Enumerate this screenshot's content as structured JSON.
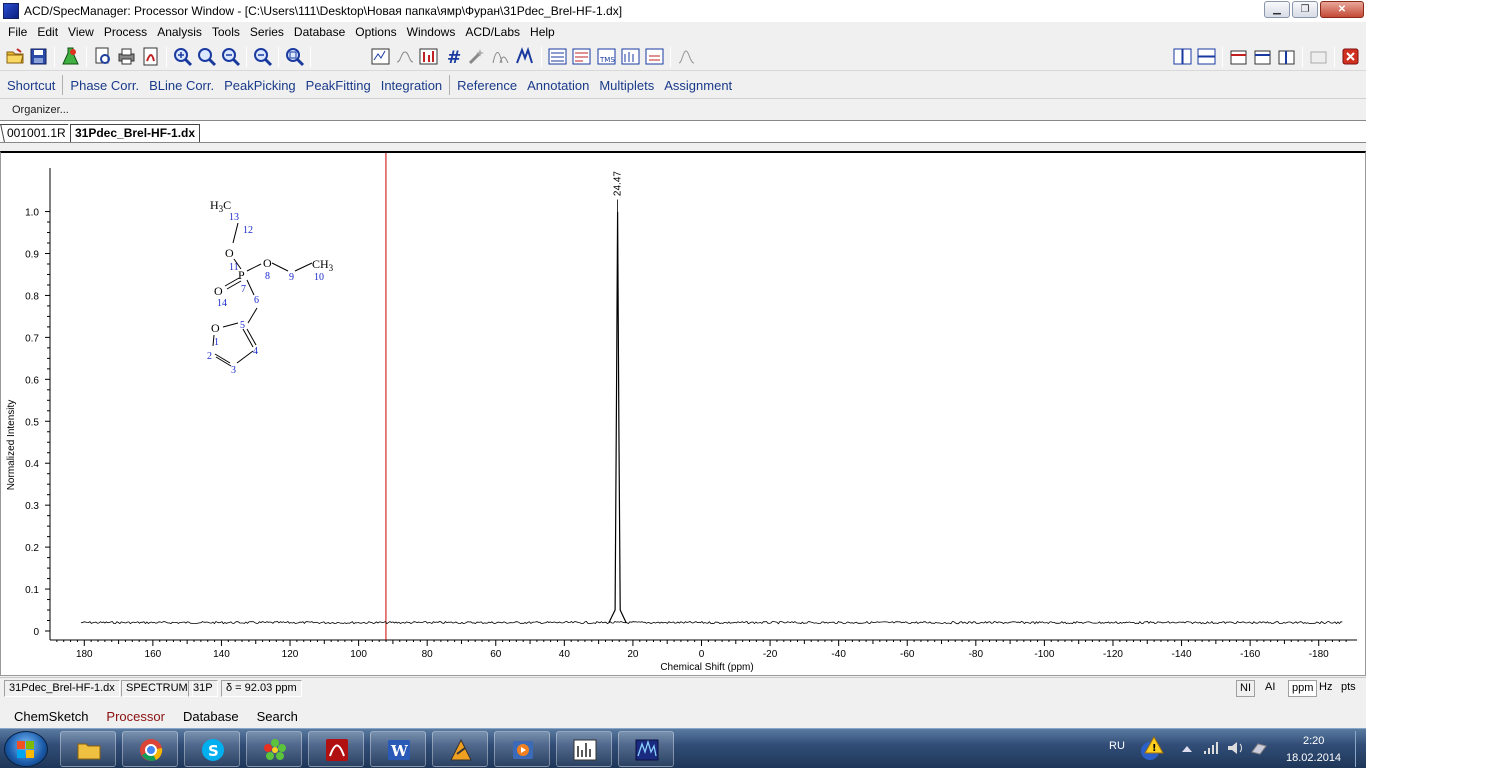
{
  "window": {
    "title": "ACD/SpecManager: Processor Window - [C:\\Users\\111\\Desktop\\Новая папка\\ямр\\Фуран\\31Pdec_Brel-HF-1.dx]",
    "minimize": "▁",
    "maximize": "❐",
    "close": "✕"
  },
  "menu": [
    "File",
    "Edit",
    "View",
    "Process",
    "Analysis",
    "Tools",
    "Series",
    "Database",
    "Options",
    "Windows",
    "ACD/Labs",
    "Help"
  ],
  "process_tabs": {
    "shortcut": "Shortcut",
    "group1": [
      "Phase Corr.",
      "BLine Corr.",
      "PeakPicking",
      "PeakFitting",
      "Integration"
    ],
    "group2": [
      "Reference",
      "Annotation",
      "Multiplets",
      "Assignment"
    ]
  },
  "organizer": "Organizer...",
  "doc_tabs": [
    "001001.1R",
    "31Pdec_Brel-HF-1.dx"
  ],
  "chart_data": {
    "type": "line",
    "xlabel": "Chemical Shift (ppm)",
    "ylabel": "Normalized Intensity",
    "x_reversed": true,
    "xlim": [
      190,
      -190
    ],
    "ylim": [
      0,
      1.08
    ],
    "x_ticks": [
      180,
      160,
      140,
      120,
      100,
      80,
      60,
      40,
      20,
      0,
      -20,
      -40,
      -60,
      -80,
      -100,
      -120,
      -140,
      -160,
      -180
    ],
    "y_ticks": [
      0,
      0.1,
      0.2,
      0.3,
      0.4,
      0.5,
      0.6,
      0.7,
      0.8,
      0.9,
      1.0
    ],
    "series": [
      {
        "x": [
          181,
          60,
          27,
          25.2,
          24.8,
          24.47,
          24.1,
          23.7,
          22,
          -20,
          -187
        ],
        "y": [
          0.02,
          0.02,
          0.02,
          0.05,
          0.56,
          1.0,
          0.48,
          0.05,
          0.02,
          0.02,
          0.02
        ]
      }
    ],
    "peak_label": "24.47",
    "peak_ppm": 24.47,
    "cursor_ppm": 92.03,
    "cursor_color": "#cc0000",
    "line_color": "#000000"
  },
  "molecule": {
    "atoms": [
      "H",
      "3",
      "C",
      "13",
      "12",
      "O",
      "11",
      "O",
      "8",
      "9",
      "CH",
      "3",
      "10",
      "P",
      "7",
      "O",
      "14",
      "6",
      "O",
      "5",
      "1",
      "2",
      "4",
      "3"
    ]
  },
  "status": {
    "file": "31Pdec_Brel-HF-1.dx",
    "type": "SPECTRUM",
    "nucleus": "31P",
    "delta": "δ = 92.03 ppm",
    "right": [
      "NI",
      "AI",
      "ppm",
      "Hz",
      "pts"
    ]
  },
  "bottom_tabs": [
    "ChemSketch",
    "Processor",
    "Database",
    "Search"
  ],
  "taskbar": {
    "lang": "RU",
    "time": "2:20",
    "date": "18.02.2014",
    "apps": [
      "explorer",
      "chrome",
      "skype",
      "icq",
      "acrobat",
      "word",
      "winamp",
      "media-player",
      "specmanager-1",
      "specmanager-2"
    ]
  }
}
